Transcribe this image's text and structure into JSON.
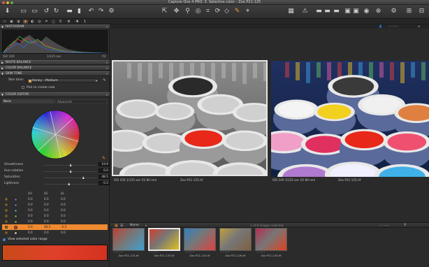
{
  "window": {
    "title": "Capture One 4 PRO: 3. Selective color – Zoo P21-125"
  },
  "toolbar": {
    "left_icons": [
      "import-icon",
      "capture-icon",
      "camera-icon",
      "rotate-left-icon",
      "rotate-right-icon",
      "folder-icon",
      "trash-icon",
      "undo-icon",
      "redo-icon",
      "settings-icon"
    ],
    "center_icons": [
      "cursor-tool-icon",
      "pan-tool-icon",
      "zoom-tool-icon",
      "loupe-tool-icon",
      "crop-tool-icon",
      "rotate-tool-icon",
      "keystone-tool-icon",
      "color-pick-tool-icon",
      "annotate-tool-icon"
    ],
    "right_icons": [
      "proof-icon",
      "warning-icon",
      "folder-a-icon",
      "folder-b-icon",
      "folder-c-icon",
      "export-a-icon",
      "export-b-icon",
      "export-c-icon",
      "camera-settings-icon",
      "stop-icon",
      "preferences-icon",
      "guide-icon",
      "grid-icon"
    ]
  },
  "tool_tabs": {
    "icons": [
      "library-tab-icon",
      "capture-tab-icon",
      "lens-tab-icon",
      "color-tab-icon",
      "exposure-tab-icon",
      "details-tab-icon",
      "adjustments-tab-icon",
      "metadata-tab-icon",
      "output-tab-icon",
      "batch-tab-icon",
      "quick-tab-icon"
    ],
    "page_number": "1"
  },
  "panels": {
    "histogram": {
      "header": "HISTOGRAM",
      "iso": "ISO 100",
      "shutter": "1/125 sec",
      "aperture": "f/2"
    },
    "white_balance": {
      "header": "WHITE BALANCE"
    },
    "color_balance": {
      "header": "COLOR BALANCE"
    },
    "skin_tone": {
      "header": "SKIN TONE",
      "label": "Skin tone:",
      "value": "Honey – Medium",
      "pick_label": "Pick to create new"
    },
    "color_editor": {
      "header": "COLOR EDITOR",
      "tab_basic": "Basic",
      "tab_advanced": "Advanced",
      "sliders": [
        {
          "label": "Smoothness",
          "value": "19.9",
          "pos": 0.5
        },
        {
          "label": "Hue rotation",
          "value": "0.0",
          "pos": 0.5
        },
        {
          "label": "Saturation",
          "value": "48.5",
          "pos": 0.74
        },
        {
          "label": "Lightness",
          "value": "-5.5",
          "pos": 0.47
        }
      ],
      "table_headers": [
        "ΔH",
        "ΔS",
        "ΔL"
      ],
      "rows": [
        {
          "color": "#7a5aa0",
          "dh": "0.0",
          "ds": "0.0",
          "dl": "0.0",
          "selected": false
        },
        {
          "color": "#5a6ab0",
          "dh": "0.0",
          "ds": "0.0",
          "dl": "0.0",
          "selected": false
        },
        {
          "color": "#4a90a0",
          "dh": "0.0",
          "ds": "0.0",
          "dl": "0.0",
          "selected": false
        },
        {
          "color": "#6a9a40",
          "dh": "0.0",
          "ds": "0.0",
          "dl": "0.0",
          "selected": false
        },
        {
          "color": "#9a8a40",
          "dh": "0.0",
          "ds": "0.0",
          "dl": "0.0",
          "selected": false
        },
        {
          "color": "#e04a2a",
          "dh": "0.0",
          "ds": "48.5",
          "dl": "-5.5",
          "selected": true
        },
        {
          "color": "#c0c0c0",
          "dh": "0.0",
          "ds": "0.0",
          "dl": "0.0",
          "selected": false
        }
      ],
      "view_range_label": "View selected color range",
      "range_color": "#dc3a22"
    }
  },
  "viewer": {
    "left_caption": {
      "info": "ISO 100   1/125 sec   f/2   80 mm",
      "name": "Zoo P21-125.tif"
    },
    "right_caption": {
      "info": "ISO 100   1/125 sec   f/2   80 mm",
      "name": "Zoo P21-125.tif"
    }
  },
  "browser": {
    "sort_label": "Name",
    "count_label": "1 of 6 images selected",
    "thumbs": [
      {
        "name": "Zoo P21-125.tif",
        "selected": false
      },
      {
        "name": "Zoo P21-125.tif",
        "selected": true
      },
      {
        "name": "Zoo P21-125.tif",
        "selected": false
      },
      {
        "name": "Zoo P21-126.tif",
        "selected": false
      },
      {
        "name": "Zoo P21-130.tif",
        "selected": false
      }
    ]
  },
  "accent": "#f08a30"
}
